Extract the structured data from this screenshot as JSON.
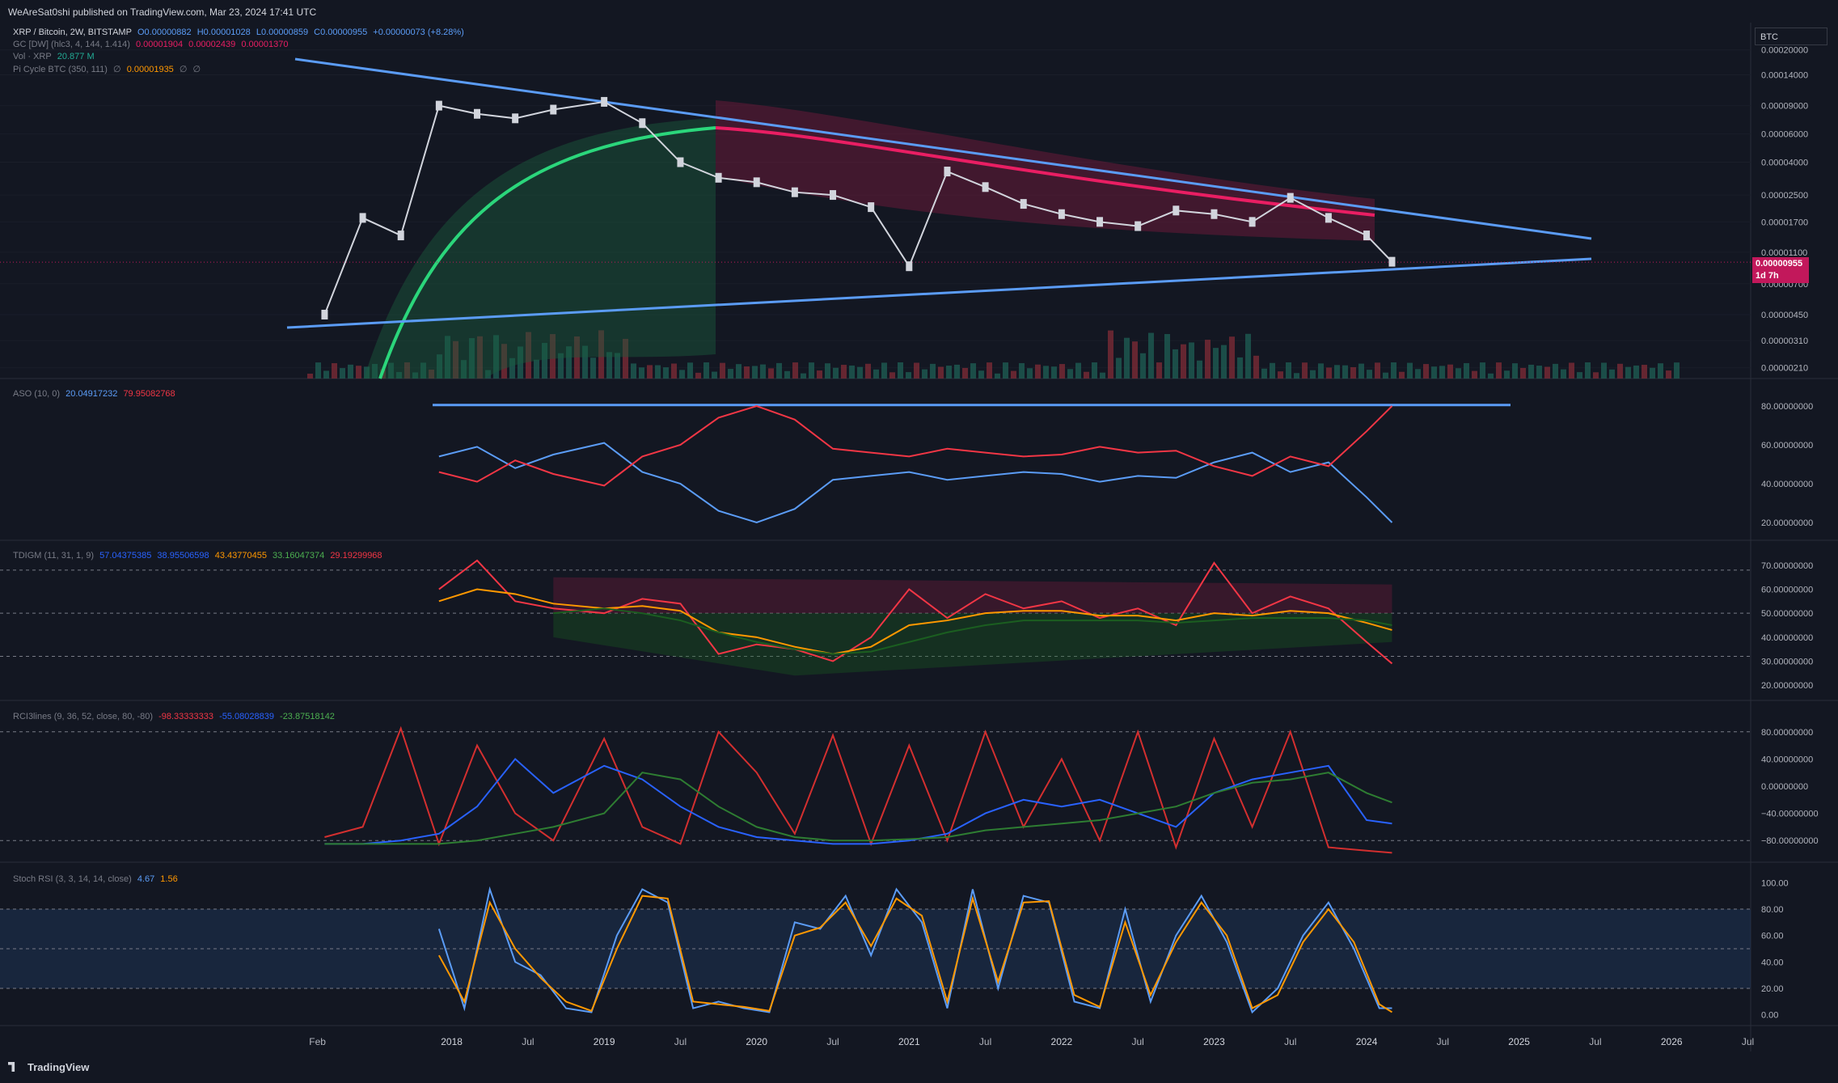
{
  "header": {
    "publisher_line": "WeAreSat0shi published on TradingView.com, Mar 23, 2024 17:41 UTC"
  },
  "footer": {
    "brand": "TradingView"
  },
  "colors": {
    "bg": "#131722",
    "grid": "#1e222d",
    "blue": "#5b9cf6",
    "red": "#f23645",
    "green": "#22ab94",
    "orange": "#ff9800",
    "pink": "#e91e63",
    "lime": "#00e676"
  },
  "price_pane": {
    "currency_box": "BTC",
    "legend": {
      "line1": {
        "title": "XRP / Bitcoin, 2W, BITSTAMP",
        "o": "O0.00000882",
        "h": "H0.00001028",
        "l": "L0.00000859",
        "c": "C0.00000955",
        "chg": "+0.00000073 (+8.28%)"
      },
      "line2": {
        "title": "GC [DW] (hlc3, 4, 144, 1.414)",
        "v1": "0.00001904",
        "v2": "0.00002439",
        "v3": "0.00001370"
      },
      "line3": {
        "title": "Vol · XRP",
        "v1": "20.877 M"
      },
      "line4": {
        "title": "Pi Cycle BTC (350, 111)",
        "v1": "∅",
        "v2": "0.00001935",
        "v3": "∅",
        "v4": "∅"
      }
    },
    "axis_labels": [
      "0.00020000",
      "0.00014000",
      "0.00009000",
      "0.00006000",
      "0.00004000",
      "0.00002500",
      "0.00001700",
      "0.00001100",
      "0.00000700",
      "0.00000450",
      "0.00000310",
      "0.00000210"
    ],
    "last_price": "0.00000955",
    "countdown": "1d 7h"
  },
  "aso_pane": {
    "legend": {
      "title": "ASO (10, 0)",
      "v1": "20.04917232",
      "v2": "79.95082768"
    },
    "axis_labels": [
      "80.00000000",
      "60.00000000",
      "40.00000000",
      "20.00000000"
    ]
  },
  "tdigm_pane": {
    "legend": {
      "title": "TDIGM (11, 31, 1, 9)",
      "v1": "57.04375385",
      "v2": "38.95506598",
      "v3": "43.43770455",
      "v4": "33.16047374",
      "v5": "29.19299968"
    },
    "axis_labels": [
      "70.00000000",
      "60.00000000",
      "50.00000000",
      "40.00000000",
      "30.00000000",
      "20.00000000"
    ]
  },
  "rci_pane": {
    "legend": {
      "title": "RCI3lines (9, 36, 52, close, 80, -80)",
      "v1": "-98.33333333",
      "v2": "-55.08028839",
      "v3": "-23.87518142"
    },
    "axis_labels": [
      "80.00000000",
      "40.00000000",
      "0.00000000",
      "−40.00000000",
      "−80.00000000"
    ]
  },
  "stoch_pane": {
    "legend": {
      "title": "Stoch RSI (3, 3, 14, 14, close)",
      "k": "4.67",
      "d": "1.56"
    },
    "axis_labels": [
      "100.00",
      "80.00",
      "60.00",
      "40.00",
      "20.00",
      "0.00"
    ]
  },
  "time_axis": [
    "Feb",
    "2018",
    "Jul",
    "2019",
    "Jul",
    "2020",
    "Jul",
    "2021",
    "Jul",
    "2022",
    "Jul",
    "2023",
    "Jul",
    "2024",
    "Jul",
    "2025",
    "Jul",
    "2026",
    "Jul"
  ],
  "chart_data": [
    {
      "type": "line",
      "pane": "price",
      "scale": "log",
      "x_axis": "time (2W bars)",
      "series": [
        {
          "name": "XRP / Bitcoin",
          "x": [
            "2017-03",
            "2017-06",
            "2017-09",
            "2017-12",
            "2018-03",
            "2018-06",
            "2018-09",
            "2019-01",
            "2019-04",
            "2019-07",
            "2019-10",
            "2020-01",
            "2020-04",
            "2020-07",
            "2020-10",
            "2021-01",
            "2021-04",
            "2021-07",
            "2021-10",
            "2022-01",
            "2022-04",
            "2022-07",
            "2022-10",
            "2023-01",
            "2023-04",
            "2023-07",
            "2023-10",
            "2024-01",
            "2024-03"
          ],
          "values": [
            4.5e-06,
            1.8e-05,
            1.4e-05,
            9e-05,
            8e-05,
            7.5e-05,
            8.5e-05,
            9.5e-05,
            7e-05,
            4e-05,
            3.2e-05,
            3e-05,
            2.6e-05,
            2.5e-05,
            2.1e-05,
            9e-06,
            3.5e-05,
            2.8e-05,
            2.2e-05,
            1.9e-05,
            1.7e-05,
            1.6e-05,
            2e-05,
            1.9e-05,
            1.7e-05,
            2.4e-05,
            1.8e-05,
            1.4e-05,
            9.6e-06
          ]
        }
      ]
    },
    {
      "type": "line",
      "pane": "ASO",
      "ylim": [
        20,
        80
      ],
      "x": [
        "2017-12",
        "2018-03",
        "2018-06",
        "2018-09",
        "2019-01",
        "2019-04",
        "2019-07",
        "2019-10",
        "2020-01",
        "2020-04",
        "2020-07",
        "2020-10",
        "2021-01",
        "2021-04",
        "2021-07",
        "2021-10",
        "2022-01",
        "2022-04",
        "2022-07",
        "2022-10",
        "2023-01",
        "2023-04",
        "2023-07",
        "2023-10",
        "2024-01",
        "2024-03"
      ],
      "series": [
        {
          "name": "bull",
          "values": [
            54,
            59,
            48,
            55,
            61,
            46,
            40,
            26,
            20,
            27,
            42,
            44,
            46,
            42,
            44,
            46,
            45,
            41,
            44,
            43,
            51,
            56,
            46,
            51,
            33,
            20
          ]
        },
        {
          "name": "bear",
          "values": [
            46,
            41,
            52,
            45,
            39,
            54,
            60,
            74,
            80,
            73,
            58,
            56,
            54,
            58,
            56,
            54,
            55,
            59,
            56,
            57,
            49,
            44,
            54,
            49,
            67,
            80
          ]
        }
      ]
    },
    {
      "type": "line",
      "pane": "TDIGM",
      "ylim": [
        20,
        70
      ],
      "x": [
        "2017-12",
        "2018-03",
        "2018-06",
        "2018-09",
        "2019-01",
        "2019-04",
        "2019-07",
        "2019-10",
        "2020-01",
        "2020-04",
        "2020-07",
        "2020-10",
        "2021-01",
        "2021-04",
        "2021-07",
        "2021-10",
        "2022-01",
        "2022-04",
        "2022-07",
        "2022-10",
        "2023-01",
        "2023-04",
        "2023-07",
        "2023-10",
        "2024-01",
        "2024-03"
      ],
      "series": [
        {
          "name": "RSI",
          "values": [
            60,
            72,
            55,
            52,
            50,
            56,
            54,
            33,
            37,
            35,
            30,
            40,
            60,
            48,
            58,
            52,
            55,
            48,
            52,
            45,
            71,
            50,
            57,
            52,
            38,
            29
          ]
        },
        {
          "name": "signal",
          "values": [
            55,
            60,
            58,
            54,
            52,
            53,
            51,
            42,
            40,
            36,
            33,
            36,
            45,
            47,
            50,
            51,
            51,
            49,
            49,
            47,
            50,
            49,
            51,
            50,
            46,
            43
          ]
        },
        {
          "name": "band mid",
          "values": [
            null,
            null,
            null,
            50,
            52,
            50,
            47,
            42,
            38,
            35,
            33,
            34,
            38,
            42,
            45,
            47,
            47,
            47,
            47,
            46,
            47,
            48,
            48,
            48,
            47,
            45
          ]
        }
      ]
    },
    {
      "type": "line",
      "pane": "RCI3lines",
      "ylim": [
        -100,
        100
      ],
      "x": [
        "2017-03",
        "2017-06",
        "2017-09",
        "2017-12",
        "2018-03",
        "2018-06",
        "2018-09",
        "2019-01",
        "2019-04",
        "2019-07",
        "2019-10",
        "2020-01",
        "2020-04",
        "2020-07",
        "2020-10",
        "2021-01",
        "2021-04",
        "2021-07",
        "2021-10",
        "2022-01",
        "2022-04",
        "2022-07",
        "2022-10",
        "2023-01",
        "2023-04",
        "2023-07",
        "2023-10",
        "2024-01",
        "2024-03"
      ],
      "series": [
        {
          "name": "short",
          "values": [
            -75,
            -60,
            85,
            -85,
            60,
            -40,
            -80,
            70,
            -60,
            -85,
            80,
            20,
            -70,
            75,
            -85,
            60,
            -80,
            80,
            -60,
            40,
            -80,
            80,
            -90,
            70,
            -60,
            80,
            -90,
            -95,
            -98
          ]
        },
        {
          "name": "mid",
          "values": [
            -85,
            -85,
            -80,
            -70,
            -30,
            40,
            -10,
            30,
            10,
            -30,
            -60,
            -75,
            -80,
            -85,
            -85,
            -80,
            -70,
            -40,
            -20,
            -30,
            -20,
            -40,
            -60,
            -10,
            10,
            20,
            30,
            -50,
            -55
          ]
        },
        {
          "name": "long",
          "values": [
            -85,
            -85,
            -85,
            -85,
            -80,
            -70,
            -60,
            -40,
            20,
            10,
            -30,
            -60,
            -75,
            -80,
            -80,
            -78,
            -75,
            -65,
            -60,
            -55,
            -50,
            -40,
            -30,
            -10,
            5,
            10,
            20,
            -10,
            -24
          ]
        }
      ]
    },
    {
      "type": "line",
      "pane": "Stoch RSI",
      "ylim": [
        0,
        100
      ],
      "x": [
        "2017-12",
        "2018-02",
        "2018-04",
        "2018-06",
        "2018-08",
        "2018-10",
        "2018-12",
        "2019-02",
        "2019-04",
        "2019-06",
        "2019-08",
        "2019-10",
        "2019-12",
        "2020-02",
        "2020-04",
        "2020-06",
        "2020-08",
        "2020-10",
        "2020-12",
        "2021-02",
        "2021-04",
        "2021-06",
        "2021-08",
        "2021-10",
        "2021-12",
        "2022-02",
        "2022-04",
        "2022-06",
        "2022-08",
        "2022-10",
        "2022-12",
        "2023-02",
        "2023-04",
        "2023-06",
        "2023-08",
        "2023-10",
        "2023-12",
        "2024-02",
        "2024-03"
      ],
      "series": [
        {
          "name": "K",
          "values": [
            65,
            5,
            95,
            40,
            30,
            5,
            2,
            60,
            95,
            85,
            5,
            10,
            5,
            2,
            70,
            65,
            90,
            45,
            95,
            70,
            5,
            95,
            20,
            90,
            85,
            10,
            5,
            80,
            10,
            60,
            90,
            55,
            2,
            20,
            60,
            85,
            50,
            5,
            5
          ]
        },
        {
          "name": "D",
          "values": [
            45,
            10,
            85,
            50,
            28,
            10,
            3,
            50,
            90,
            88,
            10,
            8,
            6,
            3,
            60,
            66,
            85,
            52,
            88,
            75,
            10,
            88,
            25,
            85,
            86,
            15,
            6,
            70,
            15,
            55,
            85,
            60,
            5,
            15,
            55,
            80,
            55,
            8,
            2
          ]
        }
      ]
    }
  ]
}
